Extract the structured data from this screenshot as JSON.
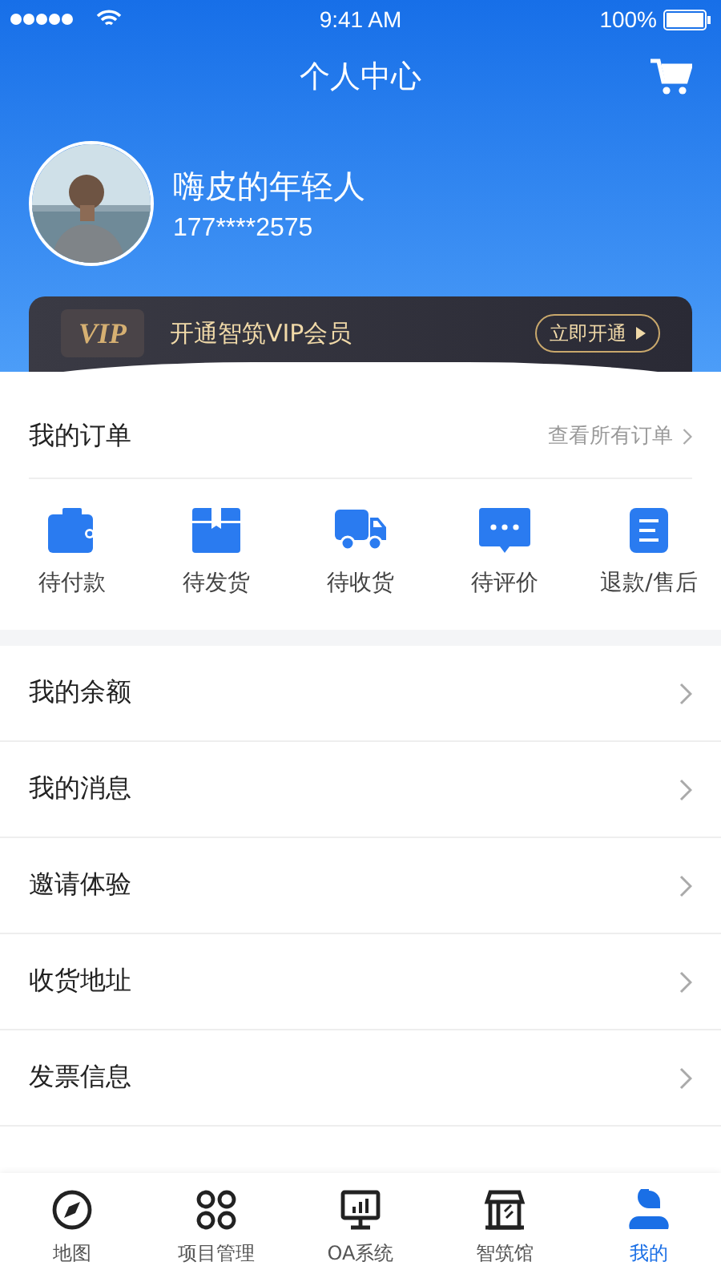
{
  "status_bar": {
    "time": "9:41 AM",
    "battery": "100%"
  },
  "header": {
    "title": "个人中心",
    "user_name": "嗨皮的年轻人",
    "phone": "177****2575"
  },
  "vip": {
    "badge": "VIP",
    "text": "开通智筑VIP会员",
    "button": "立即开通"
  },
  "orders": {
    "title": "我的订单",
    "link": "查看所有订单",
    "items": [
      {
        "label": "待付款",
        "kind": "wallet"
      },
      {
        "label": "待发货",
        "kind": "box"
      },
      {
        "label": "待收货",
        "kind": "truck"
      },
      {
        "label": "待评价",
        "kind": "chat"
      },
      {
        "label": "退款/售后",
        "kind": "document"
      }
    ]
  },
  "menu": [
    {
      "label": "我的余额"
    },
    {
      "label": "我的消息"
    },
    {
      "label": "邀请体验"
    },
    {
      "label": "收货地址"
    },
    {
      "label": "发票信息"
    }
  ],
  "tab_bar": [
    {
      "label": "地图",
      "kind": "compass",
      "selected": false
    },
    {
      "label": "项目管理",
      "kind": "grid",
      "selected": false
    },
    {
      "label": "OA系统",
      "kind": "monitor",
      "selected": false
    },
    {
      "label": "智筑馆",
      "kind": "store",
      "selected": false
    },
    {
      "label": "我的",
      "kind": "person",
      "selected": true
    }
  ]
}
